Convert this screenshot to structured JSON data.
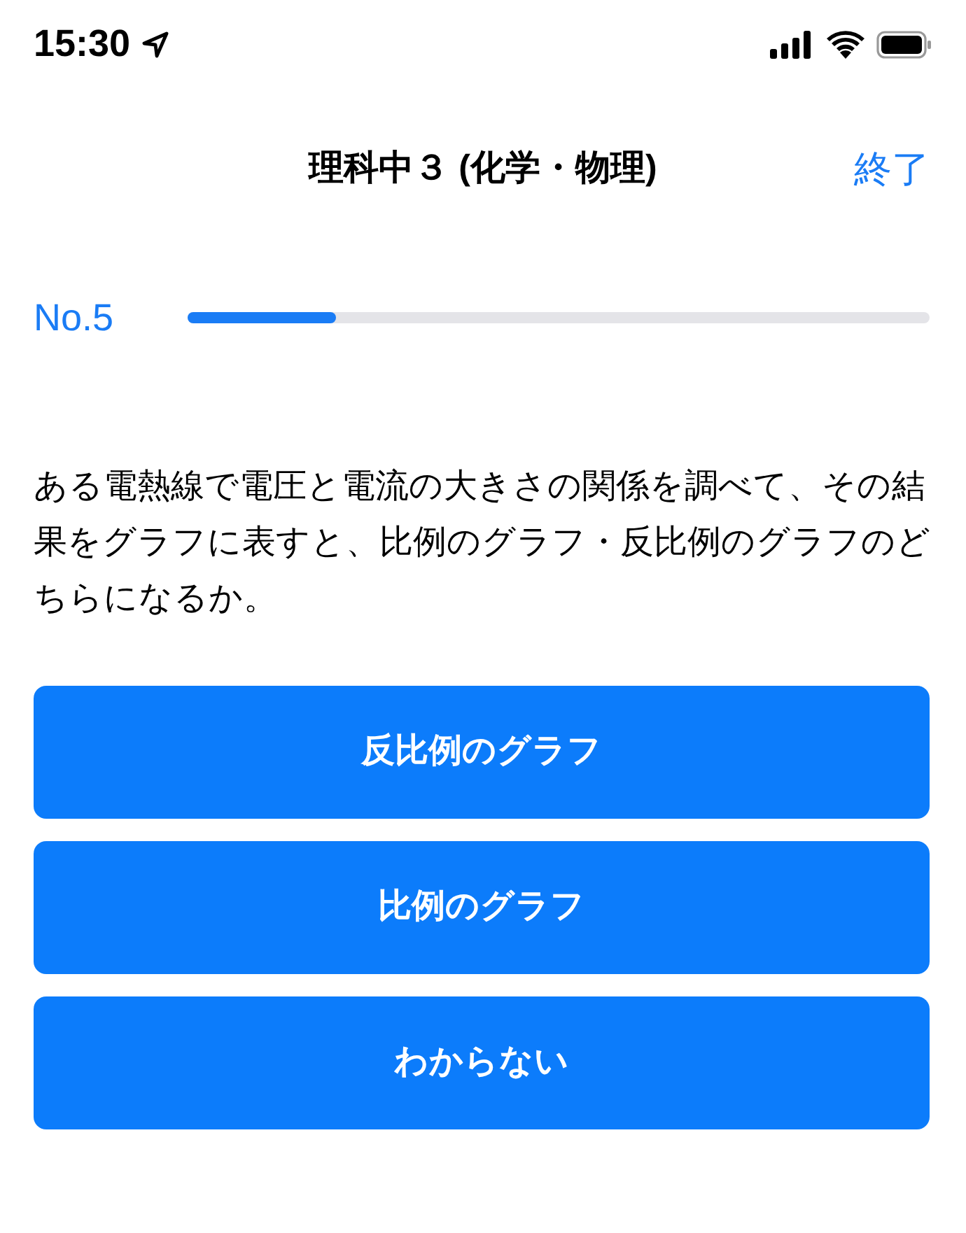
{
  "status_bar": {
    "time": "15:30"
  },
  "nav": {
    "title": "理科中３ (化学・物理)",
    "end_button": "終了"
  },
  "progress": {
    "label": "No.5",
    "level": 0.2
  },
  "question": "ある電熱線で電圧と電流の大きさの関係を調べて、その結果をグラフに表すと、比例のグラフ・反比例のグラフのどちらになるか。",
  "answers": [
    "反比例のグラフ",
    "比例のグラフ",
    "わからない"
  ]
}
